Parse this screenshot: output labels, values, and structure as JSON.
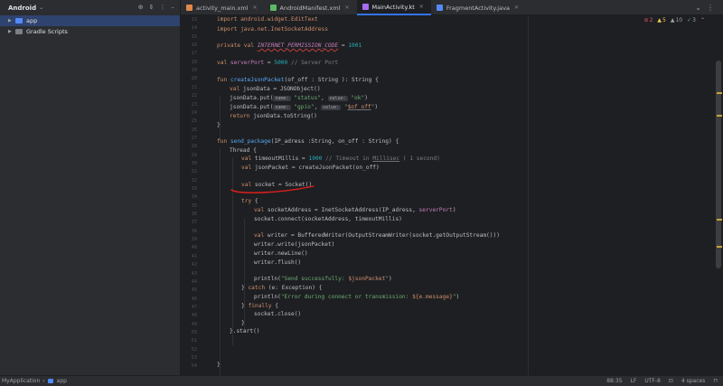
{
  "sidebar": {
    "title": "Android",
    "items": [
      {
        "label": "app",
        "icon": "folder-icon",
        "selected": true
      },
      {
        "label": "Gradle Scripts",
        "icon": "gradle-icon",
        "selected": false
      }
    ]
  },
  "tabs": [
    {
      "label": "activity_main.xml",
      "icon": "xml-icon",
      "color": "#e0874b"
    },
    {
      "label": "AndroidManifest.xml",
      "icon": "manifest-icon",
      "color": "#5fb865"
    },
    {
      "label": "MainActivity.kt",
      "icon": "kotlin-icon",
      "color": "#a86cf0",
      "active": true
    },
    {
      "label": "FragmentActivity.java",
      "icon": "java-icon",
      "color": "#548af7"
    }
  ],
  "inspections": {
    "errors": "2",
    "warnings": "5",
    "weak_warnings": "10",
    "typos": "3"
  },
  "line_numbers": [
    "13",
    "14",
    "15",
    "16",
    "17",
    "18",
    "19",
    "20",
    "21",
    "22",
    "23",
    "24",
    "25",
    "26",
    "27",
    "28",
    "29",
    "30",
    "31",
    "32",
    "33",
    "34",
    "35",
    "36",
    "37",
    "38",
    "39",
    "40",
    "41",
    "42",
    "43",
    "44",
    "45",
    "46",
    "47",
    "48",
    "49",
    "50",
    "51",
    "52",
    "53",
    "54"
  ],
  "code": {
    "l13": "import android.widget.EditText",
    "l14": "import java.net.InetSocketAddress",
    "l16_kw": "private val ",
    "l16_name": "INTERNET_PERMISSION_CODE",
    "l16_eq": " = ",
    "l16_num": "1001",
    "l18_kw": "val ",
    "l18_name": "serverPort",
    "l18_eq": " = ",
    "l18_num": "5000",
    "l18_cmt": " // Server Port",
    "l20_kw": "fun ",
    "l20_fn": "createJsonPacket",
    "l20_rest": "(of_off : String ): String {",
    "l21_kw": "val ",
    "l21_rest": "jsonData = JSONObject()",
    "l22_a": "jsonData.put(",
    "l22_hint1": "name:",
    "l22_str1": " \"status\"",
    "l22_comma": ",",
    "l22_hint2": "value:",
    "l22_str2": " \"ok\"",
    "l22_end": ")",
    "l23_a": "jsonData.put(",
    "l23_hint1": "name:",
    "l23_str1": " \"gpio\"",
    "l23_comma": ",",
    "l23_hint2": "value:",
    "l23_str2": " \"",
    "l23_tmpl": "$of_off",
    "l23_str3": "\"",
    "l23_end": ")",
    "l24_kw": "return ",
    "l24_rest": "jsonData.toString()",
    "l25": "}",
    "l27_kw": "fun ",
    "l27_fn": "send_package",
    "l27_rest": "(IP_adress :String, on_off : String) {",
    "l28": "Thread {",
    "l29_kw": "val ",
    "l29_a": "timeoutMillis = ",
    "l29_num": "1000",
    "l29_cmt": " // Timeout in ",
    "l29_cmt_ul": "Millisec",
    "l29_cmt2": " ( 1 second)",
    "l30_kw": "val ",
    "l30_rest": "jsonPacket = createJsonPacket(on_off)",
    "l32_kw": "val ",
    "l32_rest": "socket = Socket()",
    "l34_kw": "try ",
    "l34_rest": "{",
    "l35_kw": "val ",
    "l35_a": "socketAddress = InetSocketAddress(IP_adress, ",
    "l35_prop": "serverPort",
    "l35_end": ")",
    "l36": "socket.connect(socketAddress, timeoutMillis)",
    "l38_kw": "val ",
    "l38_rest": "writer = BufferedWriter(OutputStreamWriter(socket.getOutputStream()))",
    "l39": "writer.write(jsonPacket)",
    "l40": "writer.newLine()",
    "l41": "writer.flush()",
    "l43_a": "println(",
    "l43_str": "\"Send successfully: ",
    "l43_tmpl": "$jsonPacket",
    "l43_str2": "\"",
    "l43_end": ")",
    "l44_a": "} ",
    "l44_kw": "catch ",
    "l44_rest": "(e: Exception) {",
    "l45_a": "println(",
    "l45_str": "\"Error during connect or transmission: ",
    "l45_tmpl": "${e.message}",
    "l45_str2": "\"",
    "l45_end": ")",
    "l46_a": "} ",
    "l46_kw": "finally ",
    "l46_rest": "{",
    "l47": "socket.close()",
    "l48": "}",
    "l49": "}.start()",
    "l53": "}"
  },
  "statusbar": {
    "project": "MyApplication",
    "module": "app",
    "position": "88:35",
    "line_ending": "LF",
    "encoding": "UTF-8",
    "indent": "4 spaces"
  },
  "colors": {
    "annotation": "#e0201c",
    "accent": "#3574f0"
  }
}
